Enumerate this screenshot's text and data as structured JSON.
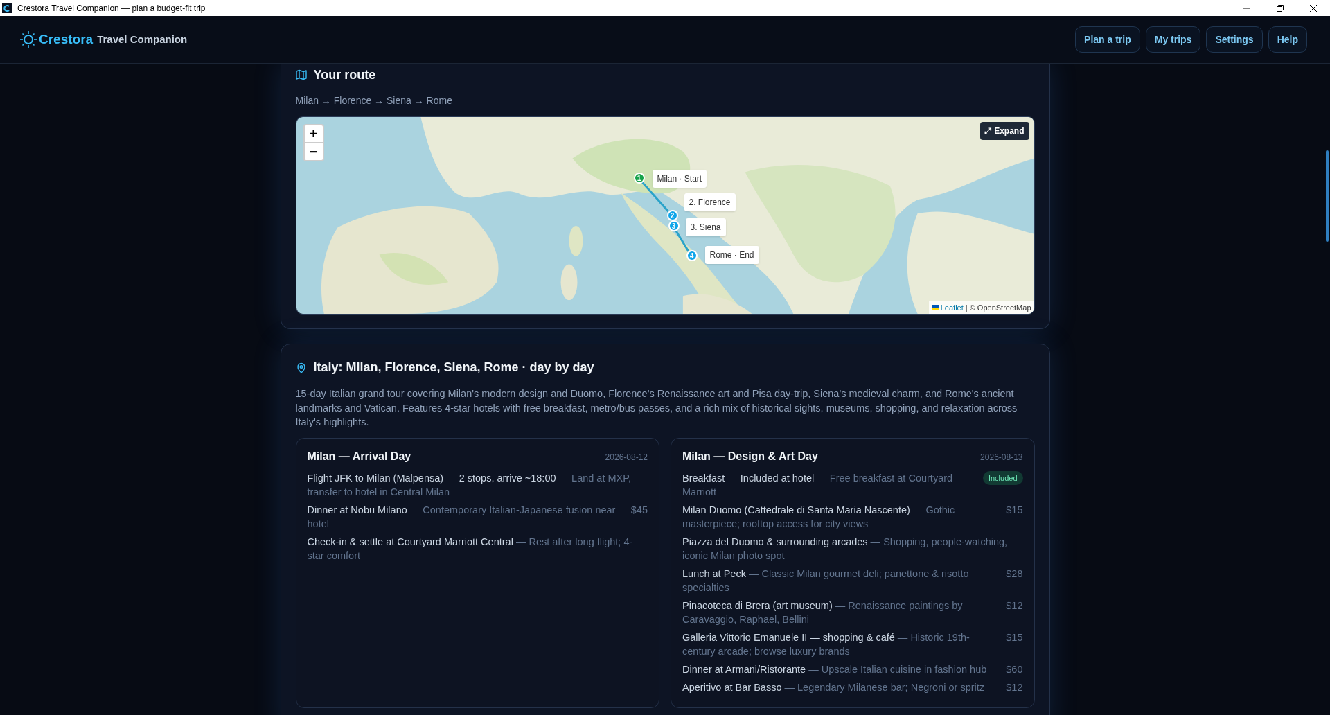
{
  "window": {
    "title": "Crestora Travel Companion — plan a budget-fit trip"
  },
  "header": {
    "brand": "Crestora",
    "subtitle": "Travel Companion",
    "nav": [
      {
        "label": "Plan a trip"
      },
      {
        "label": "My trips"
      },
      {
        "label": "Settings"
      },
      {
        "label": "Help"
      }
    ]
  },
  "route": {
    "title": "Your route",
    "path": "Milan → Florence → Siena → Rome",
    "map": {
      "zoom_in": "+",
      "zoom_out": "−",
      "expand": "⤢ Expand",
      "attribution_link": "Leaflet",
      "attribution": "| © OpenStreetMap",
      "markers": [
        {
          "number": "1",
          "label": "Milan · Start",
          "kind": "start"
        },
        {
          "number": "2",
          "label": "2. Florence",
          "kind": "stop"
        },
        {
          "number": "3",
          "label": "3. Siena",
          "kind": "stop"
        },
        {
          "number": "4",
          "label": "Rome · End",
          "kind": "end"
        }
      ]
    }
  },
  "itinerary": {
    "title": "Italy: Milan, Florence, Siena, Rome · day by day",
    "summary": "15-day Italian grand tour covering Milan's modern design and Duomo, Florence's Renaissance art and Pisa day-trip, Siena's medieval charm, and Rome's ancient landmarks and Vatican. Features 4-star hotels with free breakfast, metro/bus passes, and a rich mix of historical sights, museums, shopping, and relaxation across Italy's highlights.",
    "days": [
      {
        "title": "Milan — Arrival Day",
        "date": "2026-08-12",
        "items": [
          {
            "name": "Flight JFK to Milan (Malpensa) — 2 stops, arrive ~18:00",
            "note": "— Land at MXP, transfer to hotel in Central Milan"
          },
          {
            "name": "Dinner at Nobu Milano",
            "note": "— Contemporary Italian-Japanese fusion near hotel",
            "price": "$45"
          },
          {
            "name": "Check-in & settle at Courtyard Marriott Central",
            "note": "— Rest after long flight; 4-star comfort"
          }
        ]
      },
      {
        "title": "Milan — Design & Art Day",
        "date": "2026-08-13",
        "items": [
          {
            "name": "Breakfast — Included at hotel",
            "note": "— Free breakfast at Courtyard Marriott",
            "badge": "Included"
          },
          {
            "name": "Milan Duomo (Cattedrale di Santa Maria Nascente)",
            "note": "— Gothic masterpiece; rooftop access for city views",
            "price": "$15"
          },
          {
            "name": "Piazza del Duomo & surrounding arcades",
            "note": "— Shopping, people-watching, iconic Milan photo spot"
          },
          {
            "name": "Lunch at Peck",
            "note": "— Classic Milan gourmet deli; panettone & risotto specialties",
            "price": "$28"
          },
          {
            "name": "Pinacoteca di Brera (art museum)",
            "note": "— Renaissance paintings by Caravaggio, Raphael, Bellini",
            "price": "$12"
          },
          {
            "name": "Galleria Vittorio Emanuele II — shopping & café",
            "note": "— Historic 19th-century arcade; browse luxury brands",
            "price": "$15"
          },
          {
            "name": "Dinner at Armani/Ristorante",
            "note": "— Upscale Italian cuisine in fashion hub",
            "price": "$60"
          },
          {
            "name": "Aperitivo at Bar Basso",
            "note": "— Legendary Milanese bar; Negroni or spritz",
            "price": "$12"
          }
        ]
      }
    ]
  }
}
